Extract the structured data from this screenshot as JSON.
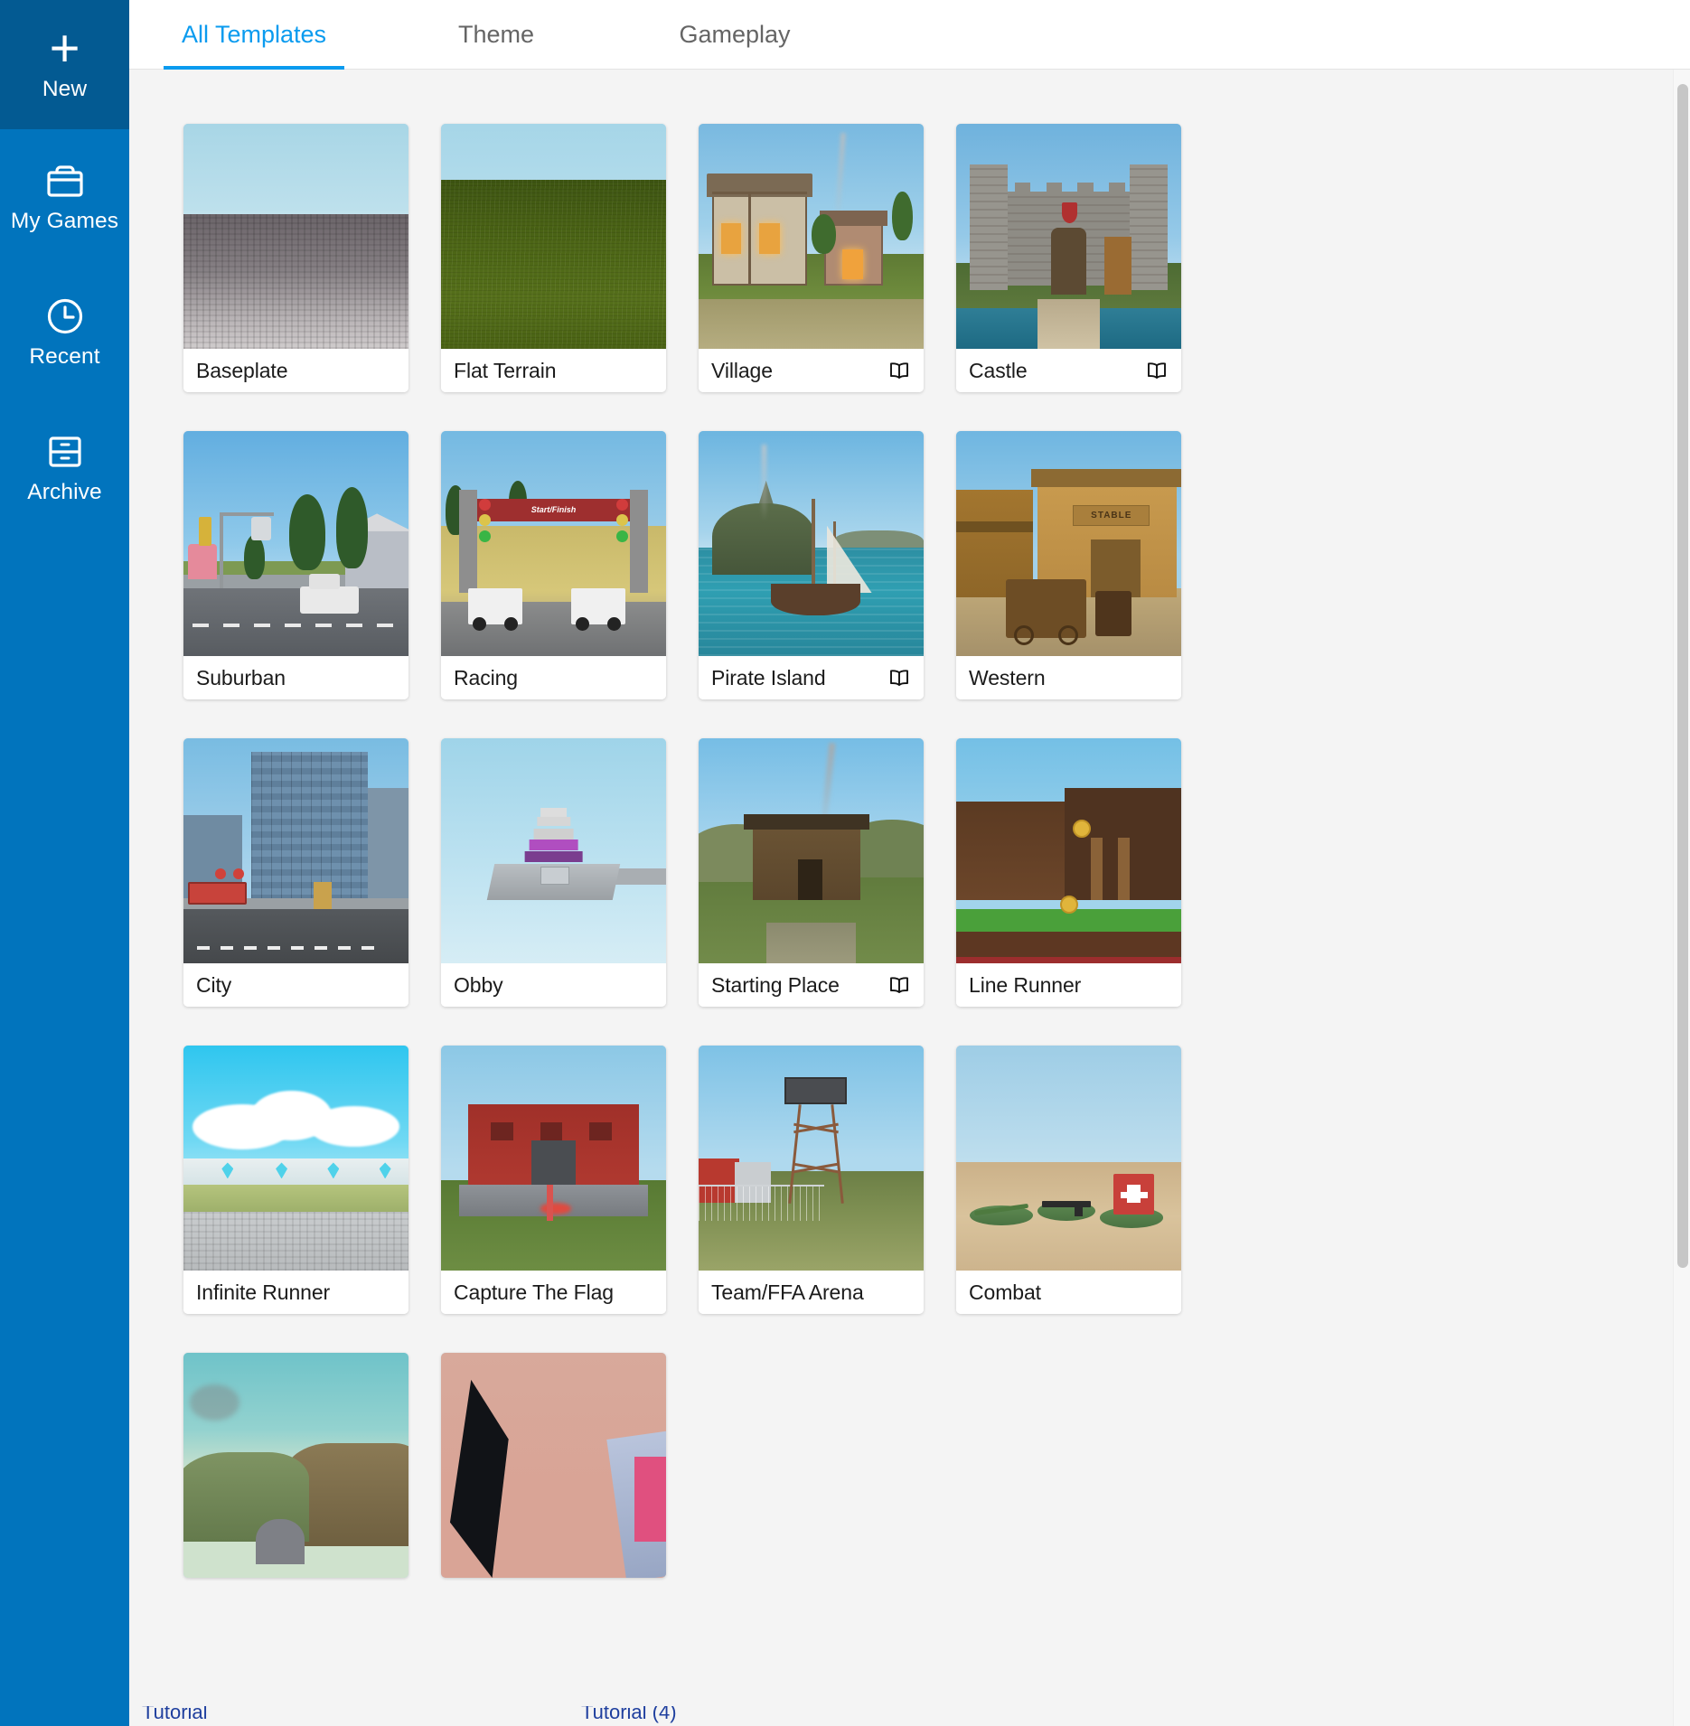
{
  "sidebar": {
    "new": {
      "label": "New",
      "icon": "plus-icon"
    },
    "items": [
      {
        "label": "My Games",
        "icon": "briefcase-icon"
      },
      {
        "label": "Recent",
        "icon": "clock-icon"
      },
      {
        "label": "Archive",
        "icon": "archive-drawer-icon"
      }
    ]
  },
  "tabs": [
    {
      "label": "All Templates",
      "active": true
    },
    {
      "label": "Theme",
      "active": false
    },
    {
      "label": "Gameplay",
      "active": false
    }
  ],
  "colors": {
    "sidebar_bg": "#0174bd",
    "sidebar_new_bg": "#035a92",
    "accent": "#0a9bef",
    "tab_inactive": "#656565",
    "content_bg": "#f4f4f4",
    "card_bg": "#ffffff",
    "card_title": "#1b1b1b",
    "scrollbar_thumb": "#c6c6c6"
  },
  "templates": [
    {
      "title": "Baseplate",
      "has_book": false,
      "art": "t-baseplate"
    },
    {
      "title": "Flat Terrain",
      "has_book": false,
      "art": "t-flat"
    },
    {
      "title": "Village",
      "has_book": true,
      "art": "t-village"
    },
    {
      "title": "Castle",
      "has_book": true,
      "art": "t-castle"
    },
    {
      "title": "Suburban",
      "has_book": false,
      "art": "t-sub"
    },
    {
      "title": "Racing",
      "has_book": false,
      "art": "t-racing"
    },
    {
      "title": "Pirate Island",
      "has_book": true,
      "art": "t-pirate"
    },
    {
      "title": "Western",
      "has_book": false,
      "art": "t-west"
    },
    {
      "title": "City",
      "has_book": false,
      "art": "t-city"
    },
    {
      "title": "Obby",
      "has_book": false,
      "art": "t-obby"
    },
    {
      "title": "Starting Place",
      "has_book": true,
      "art": "t-start"
    },
    {
      "title": "Line Runner",
      "has_book": false,
      "art": "t-line"
    },
    {
      "title": "Infinite Runner",
      "has_book": false,
      "art": "t-inf"
    },
    {
      "title": "Capture The Flag",
      "has_book": false,
      "art": "t-ctf"
    },
    {
      "title": "Team/FFA Arena",
      "has_book": false,
      "art": "t-team"
    },
    {
      "title": "Combat",
      "has_book": false,
      "art": "t-combat"
    }
  ],
  "partial_row": [
    {
      "art": "t-tut1"
    },
    {
      "art": "t-tut2"
    }
  ],
  "bottom_overlay": {
    "left_text": "Tutorial",
    "right_text": "Tutorial (4)"
  },
  "thumb_text": {
    "racing_banner": "Start/Finish",
    "western_sign": "STABLE"
  },
  "scrollbar": {
    "name": "vertical-scrollbar"
  }
}
